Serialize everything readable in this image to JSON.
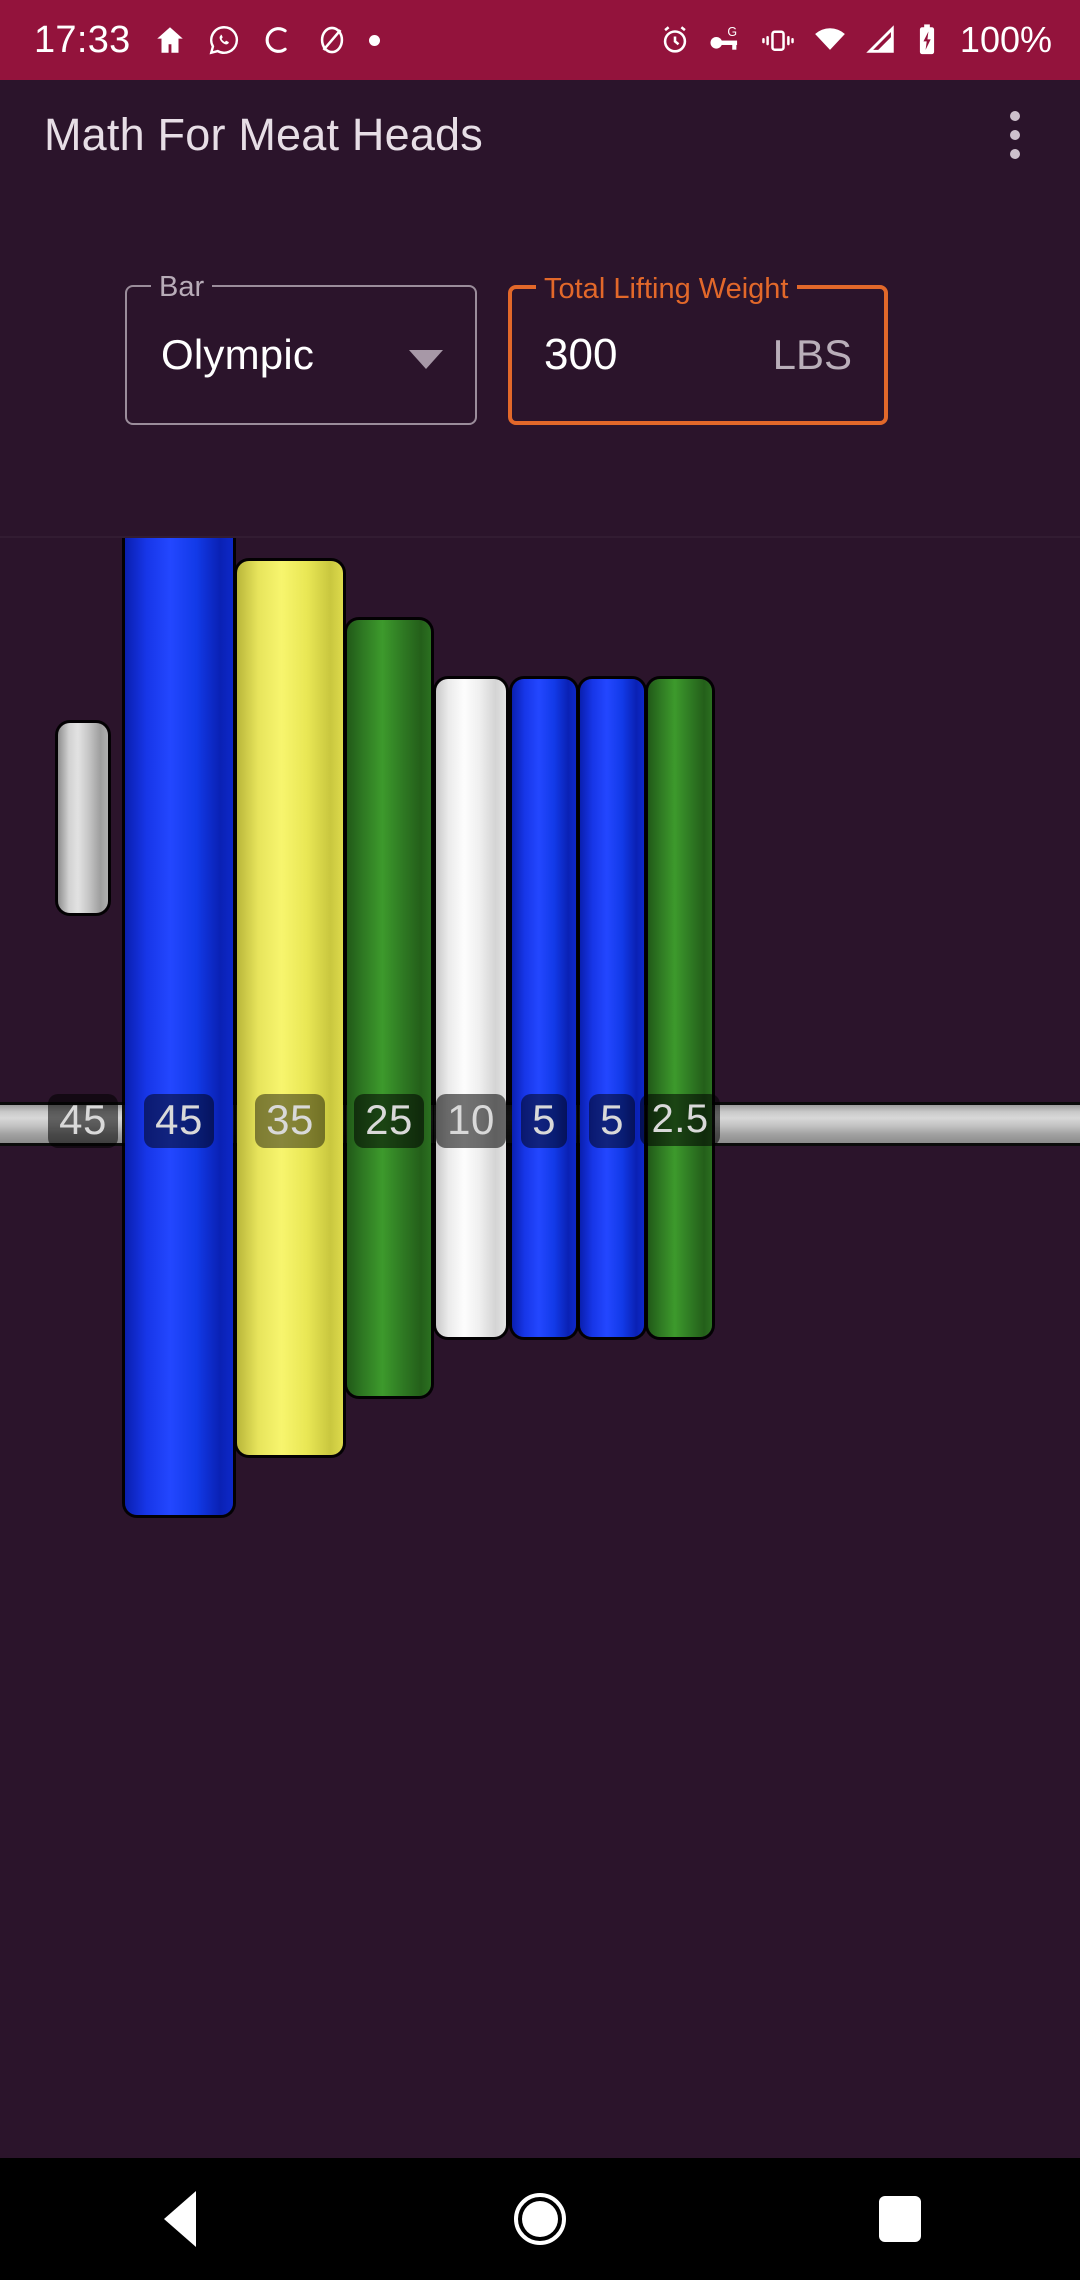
{
  "status_bar": {
    "clock": "17:33",
    "battery_percent": "100%",
    "left_icons": [
      "home-icon",
      "whatsapp-icon",
      "sync-icon",
      "do-not-disturb-icon",
      "dot-icon"
    ],
    "right_icons": [
      "alarm-icon",
      "vpn-key-icon",
      "vibrate-icon",
      "wifi-icon",
      "signal-icon",
      "battery-icon"
    ],
    "background_color": "#93133c"
  },
  "app_bar": {
    "title": "Math For Meat Heads",
    "overflow_menu_label": "More options"
  },
  "controls": {
    "bar_field": {
      "legend": "Bar",
      "value": "Olympic",
      "options": [
        "Olympic"
      ]
    },
    "weight_field": {
      "legend": "Total Lifting Weight",
      "value": "300",
      "unit": "LBS",
      "accent_color": "#e2682a"
    }
  },
  "barbell": {
    "bar_color": "#c9c9c9",
    "plates": [
      {
        "label": "45",
        "color": "#b9b9b9",
        "type": "collar"
      },
      {
        "label": "45",
        "color": "#1230e8",
        "type": "plate"
      },
      {
        "label": "35",
        "color": "#eae84a",
        "type": "plate"
      },
      {
        "label": "25",
        "color": "#2f7a23",
        "type": "plate"
      },
      {
        "label": "10",
        "color": "#f2f2f2",
        "type": "plate"
      },
      {
        "label": "5",
        "color": "#1230e8",
        "type": "plate"
      },
      {
        "label": "5",
        "color": "#1230e8",
        "type": "plate"
      },
      {
        "label": "2.5",
        "color": "#2f7a23",
        "type": "plate"
      }
    ]
  },
  "nav_bar": {
    "back_label": "Back",
    "home_label": "Home",
    "recents_label": "Recents"
  }
}
